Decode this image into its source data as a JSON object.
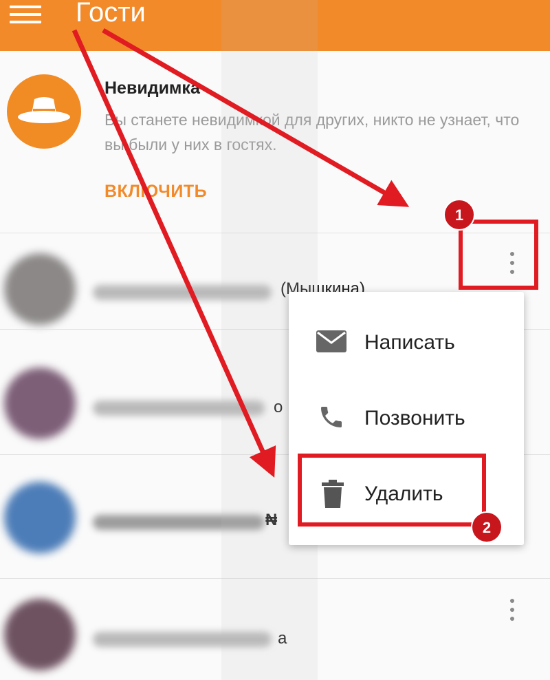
{
  "appbar": {
    "title": "Гости",
    "menu_icon": "hamburger-menu-icon"
  },
  "invisible": {
    "title": "Невидимка",
    "description": "Вы станете невидимкой для других, никто не узнает, что вы были у них в гостях.",
    "enable_label": "ВКЛЮЧИТЬ",
    "icon": "hat-icon"
  },
  "guests": [
    {
      "name_suffix": "(Мышкина)"
    },
    {
      "name_suffix": "о"
    },
    {
      "name_suffix": "₦"
    },
    {
      "name_suffix": "а"
    }
  ],
  "context_menu": {
    "items": [
      {
        "label": "Написать",
        "icon": "envelope-icon"
      },
      {
        "label": "Позвонить",
        "icon": "phone-icon"
      },
      {
        "label": "Удалить",
        "icon": "trash-icon"
      }
    ]
  },
  "annotations": {
    "step_1": "1",
    "step_2": "2",
    "color": "#e01b22"
  },
  "colors": {
    "brand_orange": "#f28a2a"
  }
}
